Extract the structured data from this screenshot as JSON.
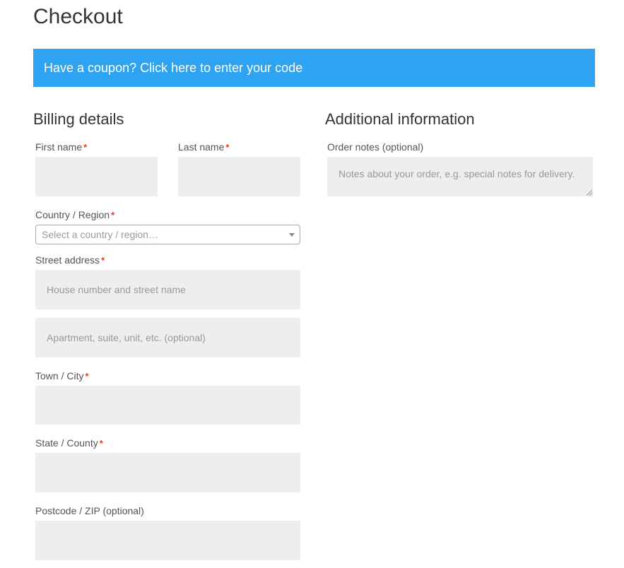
{
  "page": {
    "title": "Checkout"
  },
  "coupon": {
    "text": "Have a coupon? Click here to enter your code",
    "background_color": "#2ea3f2"
  },
  "billing": {
    "heading": "Billing details",
    "required_marker": "*",
    "fields": {
      "first_name": {
        "label": "First name",
        "value": "",
        "placeholder": ""
      },
      "last_name": {
        "label": "Last name",
        "value": "",
        "placeholder": ""
      },
      "country": {
        "label": "Country / Region",
        "placeholder": "Select a country / region…",
        "selected": ""
      },
      "street": {
        "label": "Street address",
        "line1_placeholder": "House number and street name",
        "line2_placeholder": "Apartment, suite, unit, etc. (optional)"
      },
      "city": {
        "label": "Town / City",
        "value": ""
      },
      "state": {
        "label": "State / County",
        "value": ""
      },
      "postcode": {
        "label": "Postcode / ZIP (optional)",
        "value": ""
      }
    }
  },
  "additional": {
    "heading": "Additional information",
    "order_notes": {
      "label": "Order notes (optional)",
      "placeholder": "Notes about your order, e.g. special notes for delivery."
    }
  },
  "colors": {
    "required": "#e2401c",
    "input_background": "#eeeeee"
  }
}
